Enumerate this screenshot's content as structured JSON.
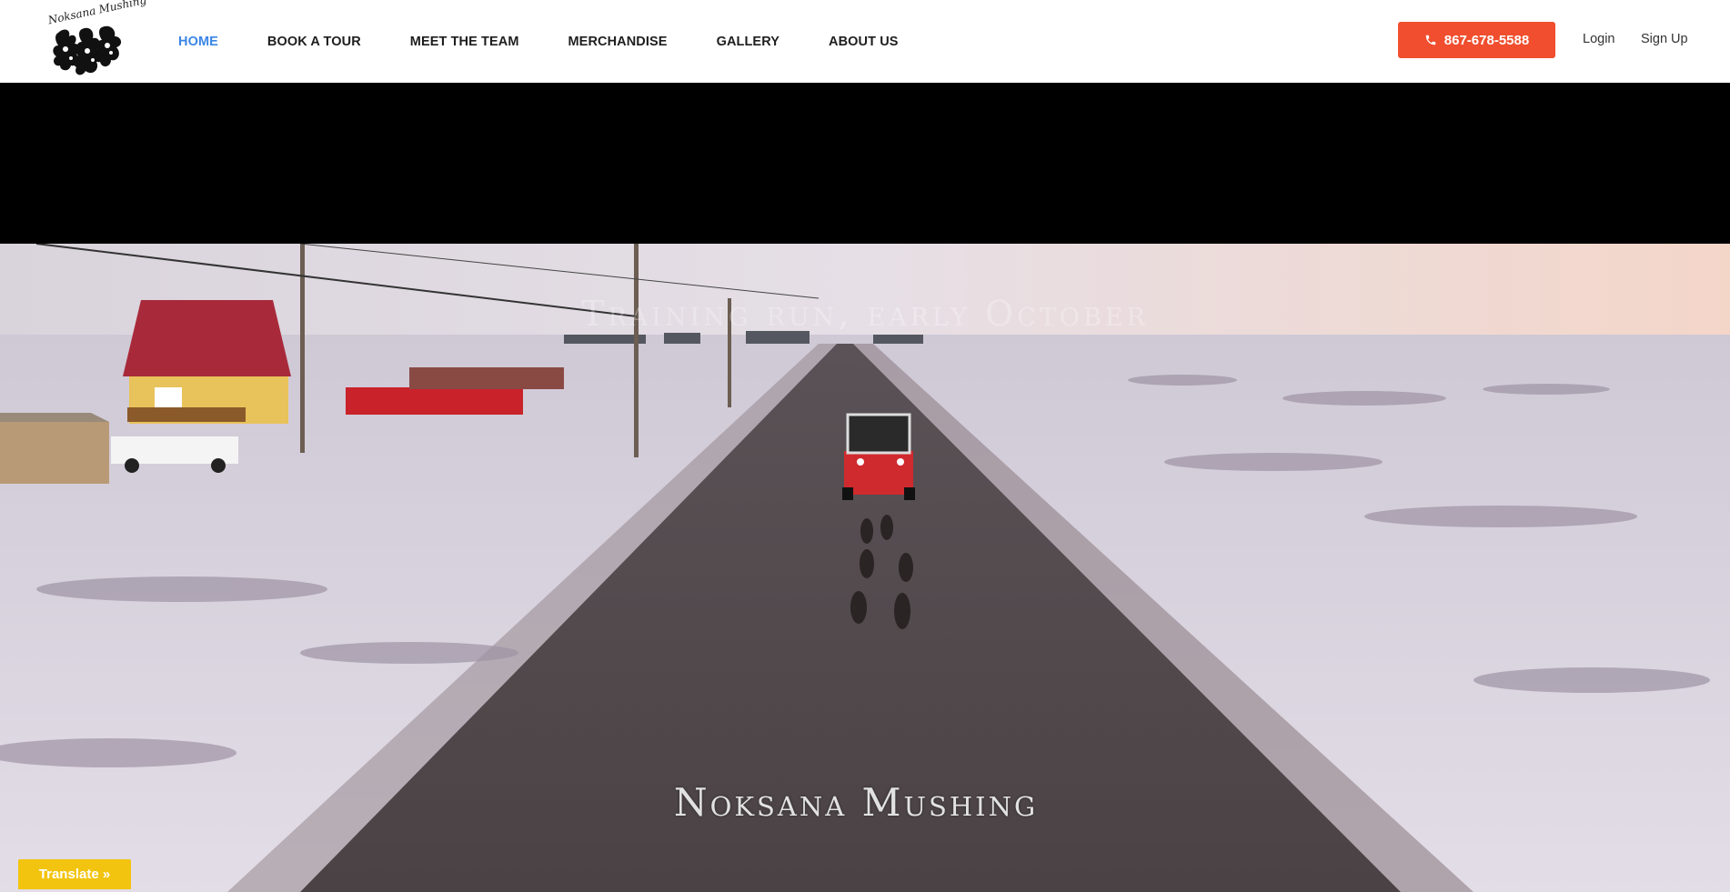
{
  "header": {
    "logo_text": "Noksana Mushing",
    "nav": [
      {
        "label": "HOME",
        "active": true
      },
      {
        "label": "BOOK A TOUR",
        "active": false
      },
      {
        "label": "MEET THE TEAM",
        "active": false
      },
      {
        "label": "MERCHANDISE",
        "active": false
      },
      {
        "label": "GALLERY",
        "active": false
      },
      {
        "label": "ABOUT US",
        "active": false
      }
    ],
    "phone": "867-678-5588",
    "login": "Login",
    "signup": "Sign Up"
  },
  "video": {
    "overlay_top": "Training run, early October",
    "overlay_title": "Noksana Mushing"
  },
  "translate": {
    "label": "Translate »"
  },
  "colors": {
    "accent_nav": "#3a86e6",
    "phone_button": "#f04e2e",
    "translate_button": "#f2c40f"
  }
}
